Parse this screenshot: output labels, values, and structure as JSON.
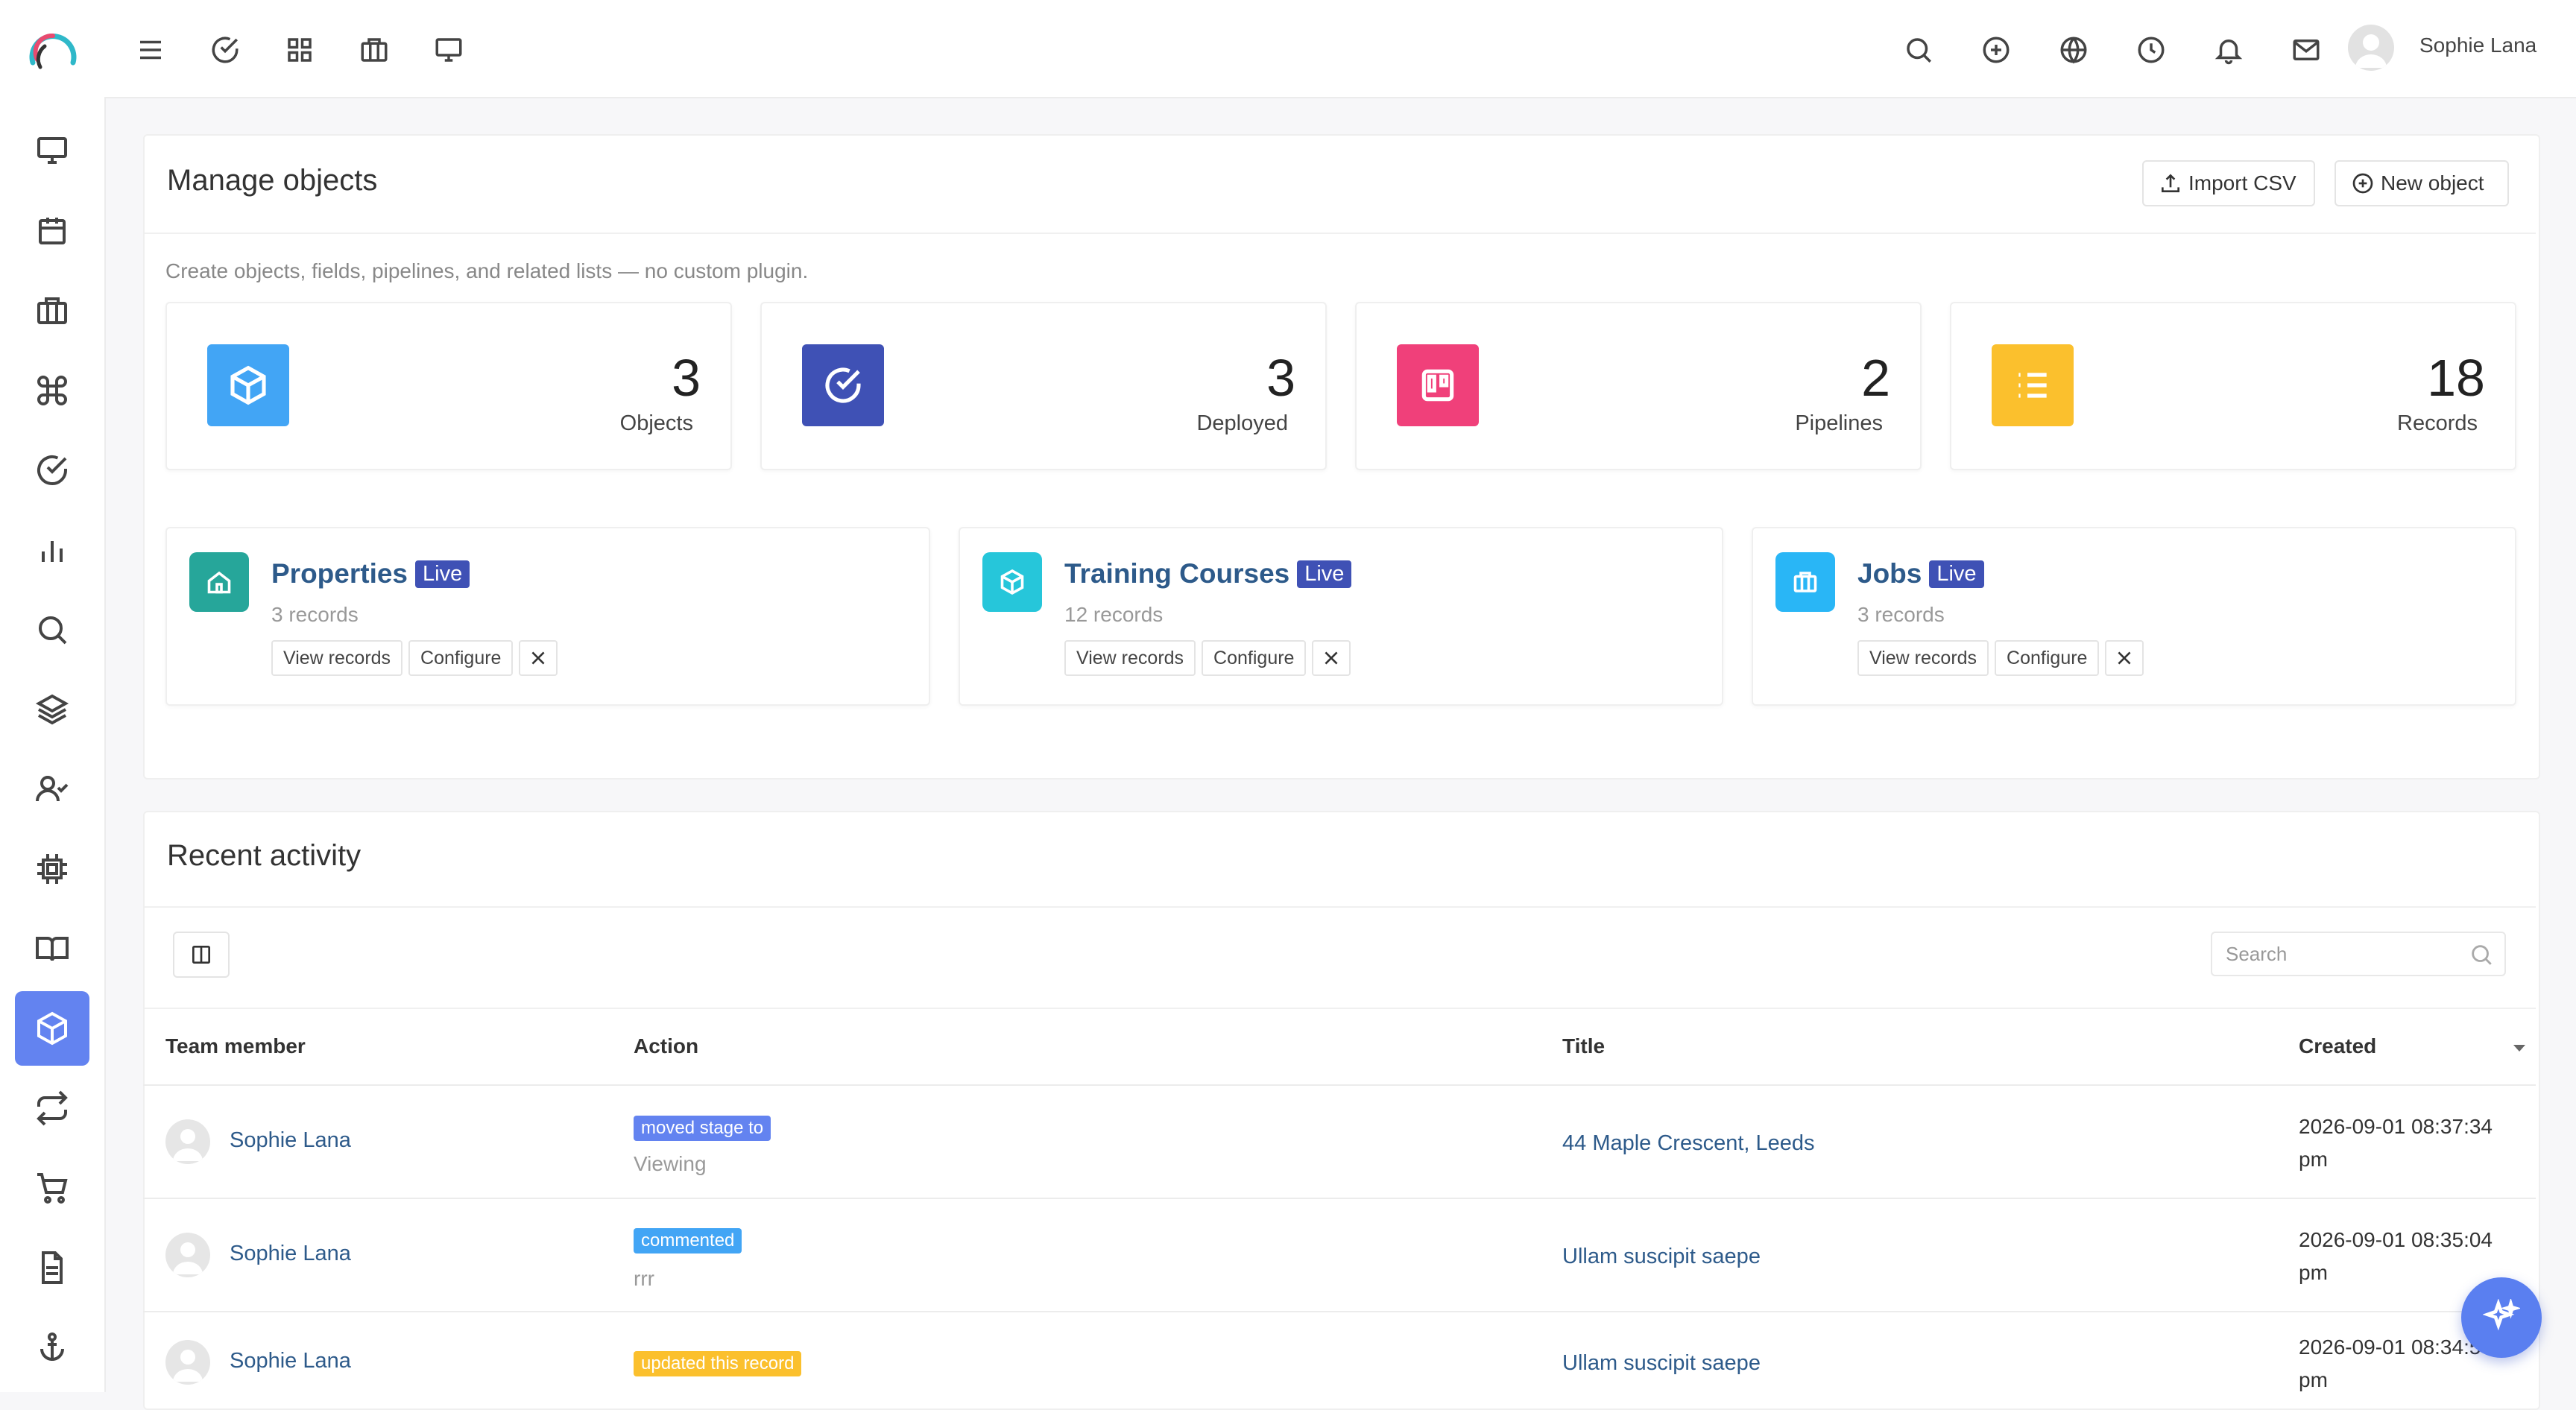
{
  "header": {
    "user_name": "Sophie Lana",
    "left_icons": [
      "menu-icon",
      "check-circle-icon",
      "grid-icon",
      "briefcase-icon",
      "monitor-icon"
    ],
    "right_icons": [
      "search-icon",
      "plus-circle-icon",
      "globe-icon",
      "clock-icon",
      "bell-icon",
      "mail-icon"
    ]
  },
  "sidebar": {
    "items": [
      "monitor-icon",
      "calendar-icon",
      "briefcase-icon",
      "command-icon",
      "check-circle-icon",
      "bar-chart-icon",
      "search-icon",
      "layers-icon",
      "user-check-icon",
      "cpu-icon",
      "book-icon",
      "box-icon",
      "repeat-icon",
      "shopping-cart-icon",
      "file-text-icon",
      "anchor-icon"
    ],
    "active": "box-icon"
  },
  "manage": {
    "title": "Manage objects",
    "import_label": "Import CSV",
    "new_label": "New object",
    "subtitle": "Create objects, fields, pipelines, and related lists — no custom plugin."
  },
  "stats": [
    {
      "value": "3",
      "label": "Objects",
      "color": "#42a5f5",
      "icon": "box-icon"
    },
    {
      "value": "3",
      "label": "Deployed",
      "color": "#3f51b5",
      "icon": "check-circle-icon"
    },
    {
      "value": "2",
      "label": "Pipelines",
      "color": "#f0407a",
      "icon": "kanban-icon"
    },
    {
      "value": "18",
      "label": "Records",
      "color": "#fbc02d",
      "icon": "list-icon"
    }
  ],
  "objects": [
    {
      "name": "Properties",
      "badge": "Live",
      "count": "3 records",
      "color": "#26a69a",
      "icon": "home-icon",
      "view": "View records",
      "configure": "Configure"
    },
    {
      "name": "Training Courses",
      "badge": "Live",
      "count": "12 records",
      "color": "#26c6da",
      "icon": "box-icon",
      "view": "View records",
      "configure": "Configure"
    },
    {
      "name": "Jobs",
      "badge": "Live",
      "count": "3 records",
      "color": "#29b6f6",
      "icon": "briefcase-icon",
      "view": "View records",
      "configure": "Configure"
    }
  ],
  "activity": {
    "title": "Recent activity",
    "search_placeholder": "Search",
    "columns": [
      "Team member",
      "Action",
      "Title",
      "Created"
    ],
    "rows": [
      {
        "member": "Sophie Lana",
        "tag": "moved stage to",
        "tag_color": "#6383f0",
        "detail": "Viewing",
        "title": "44 Maple Crescent, Leeds",
        "created_date": "2026-09-01 08:37:34",
        "created_ampm": "pm"
      },
      {
        "member": "Sophie Lana",
        "tag": "commented",
        "tag_color": "#42a5f5",
        "detail": "rrr",
        "title": "Ullam suscipit saepe",
        "created_date": "2026-09-01 08:35:04",
        "created_ampm": "pm"
      },
      {
        "member": "Sophie Lana",
        "tag": "updated this record",
        "tag_color": "#fbc02d",
        "detail": "",
        "title": "Ullam suscipit saepe",
        "created_date": "2026-09-01 08:34:5",
        "created_ampm": "pm"
      }
    ]
  }
}
